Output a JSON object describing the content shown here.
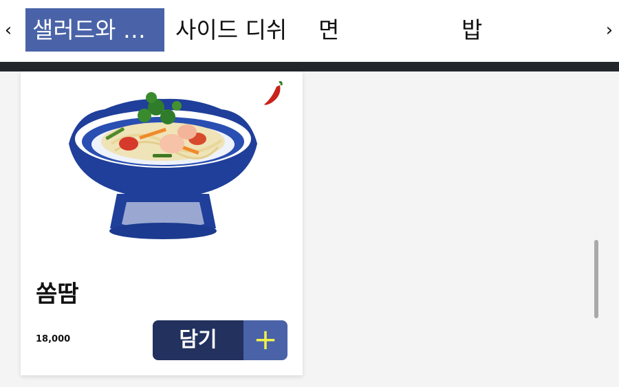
{
  "nav": {
    "prev": "‹",
    "next": "›",
    "tabs": [
      {
        "label": "샐러드와 …",
        "active": true
      },
      {
        "label": "사이드 디쉬",
        "active": false
      },
      {
        "label": "면",
        "active": false
      },
      {
        "label": "밥",
        "active": false
      }
    ]
  },
  "item": {
    "name": "쏨땀",
    "price": "18,000",
    "add_label": "담기",
    "add_icon": "+",
    "spicy": true
  },
  "colors": {
    "active_tab": "#4a63a8",
    "button_dark": "#22315e",
    "plus_color": "#f2f24a",
    "bar": "#23272b"
  }
}
